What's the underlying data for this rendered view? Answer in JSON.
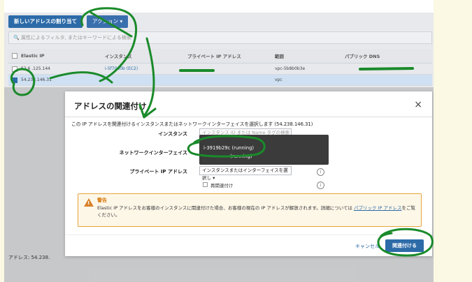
{
  "toolbar": {
    "new_address": "新しいアドレスの割り当て",
    "actions": "アクション ▾"
  },
  "filter": {
    "placeholder": "属性によるフィルタ, またはキーワードによる検索"
  },
  "table": {
    "headers": [
      "Elastic IP",
      "インスタンス",
      "プライベート IP アドレス",
      "範囲",
      "パブリック DNS"
    ],
    "rows": [
      {
        "ip": "52.6 .125.144",
        "instance": "i-5f70d0b (EC2)",
        "scope": "vpc-5b8b0b3e",
        "selected": false
      },
      {
        "ip": "54.238.146.31",
        "instance": "",
        "scope": "vpc",
        "selected": true
      }
    ]
  },
  "bottom": {
    "address_label": "アドレス: 54.238."
  },
  "modal": {
    "title": "アドレスの関連付け",
    "close": "×",
    "description": "この IP アドレスを関連付けるインスタンスまたはネットワークインターフェイスを選択します (54.238.146.31)",
    "instance_label": "インスタンス",
    "instance_placeholder": "インスタンス ID または Name タグの検索",
    "network_label": "ネットワークインターフェイス",
    "private_ip_label": "プライベート IP アドレス",
    "private_ip_select": "インスタンスまたはインターフェイスを選択し ▾",
    "reassoc_label": "再関連付け",
    "dropdown_items": [
      "i-3919b29c (running)",
      "(running)"
    ],
    "warning_title": "警告",
    "warning_text": "Elastic IP アドレスをお客様のインスタンスに関連付けた場合、お客様の現在の IP アドレスが解放されます。詳細については ",
    "warning_link": "パブリック IP アドレス",
    "warning_tail": "をご覧ください。",
    "cancel": "キャンセル",
    "associate": "関連付ける"
  },
  "colors": {
    "primary": "#2d6ba8",
    "warning": "#e8a33d",
    "scribble": "#1a8a2a"
  }
}
